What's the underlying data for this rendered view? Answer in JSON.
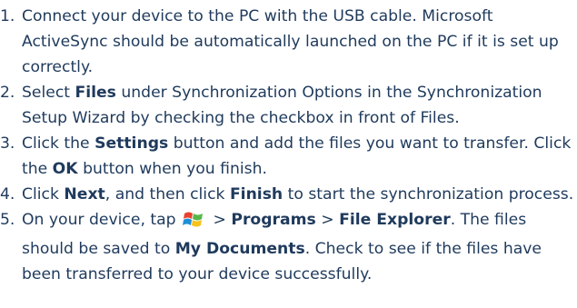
{
  "steps": [
    {
      "num": "1.",
      "text": "Connect your device to the PC with the USB cable. Microsoft ActiveSync should be automatically launched on the PC if it is set up correctly."
    },
    {
      "num": "2.",
      "t1": "Select ",
      "b1": "Files",
      "t2": " under Synchronization Options in the Synchronization Setup Wizard by checking the checkbox in front of Files."
    },
    {
      "num": "3.",
      "t1": "Click the ",
      "b1": "Settings",
      "t2": " button and add the files you want to transfer. Click the ",
      "b2": "OK",
      "t3": " button when you finish."
    },
    {
      "num": "4.",
      "t1": "Click ",
      "b1": "Next",
      "t2": ", and then click ",
      "b2": "Finish",
      "t3": " to start the synchronization process."
    },
    {
      "num": "5.",
      "t1": "On your device, tap ",
      "icon": "windows-start-icon",
      "t2": " > ",
      "b1": "Programs",
      "t3": " > ",
      "b2": "File Explorer",
      "t4": ". The files should be saved to ",
      "b3": "My Documents",
      "t5": ". Check to see if the files have been transferred to your device successfully."
    }
  ]
}
